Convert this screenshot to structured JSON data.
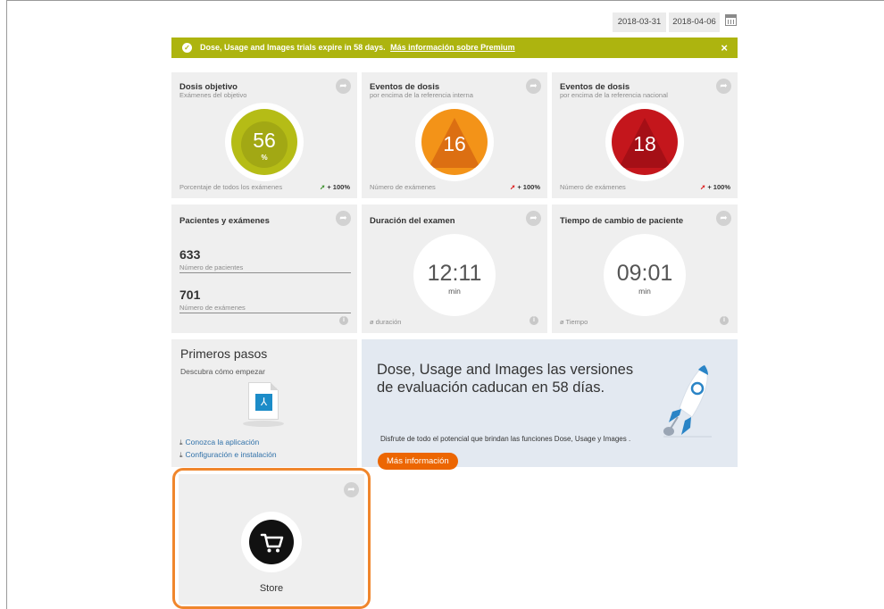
{
  "dates": {
    "from": "2018-03-31",
    "to": "2018-04-06"
  },
  "banner": {
    "message": "Dose, Usage and Images trials expire in 58 days.",
    "link": "Más información sobre Premium",
    "close": "×",
    "color": "#adb40f"
  },
  "tiles": {
    "target_dose": {
      "title": "Dosis objetivo",
      "subtitle": "Exámenes del objetivo",
      "value": "56",
      "unit": "%",
      "footer": "Porcentaje de todos los exámenes",
      "trend": "+ 100%",
      "color": "#b5bc16"
    },
    "dose_events_internal": {
      "title": "Eventos de dosis",
      "subtitle": "por encima de la referencia interna",
      "value": "16",
      "footer": "Número de exámenes",
      "trend": "+ 100%",
      "color": "#f39318"
    },
    "dose_events_national": {
      "title": "Eventos de dosis",
      "subtitle": "por encima de la referencia nacional",
      "value": "18",
      "footer": "Número de exámenes",
      "trend": "+ 100%",
      "color": "#c4161c"
    },
    "patients_exams": {
      "title": "Pacientes y exámenes",
      "patients_value": "633",
      "patients_label": "Número de pacientes",
      "exams_value": "701",
      "exams_label": "Número de exámenes"
    },
    "exam_duration": {
      "title": "Duración del examen",
      "time": "12:11",
      "unit": "min",
      "footer": "ø duración"
    },
    "patient_change": {
      "title": "Tiempo de cambio de paciente",
      "time": "09:01",
      "unit": "min",
      "footer": "ø Tiempo"
    },
    "getting_started": {
      "title": "Primeros pasos",
      "subtitle": "Descubra cómo empezar",
      "link1": "Conozca la aplicación",
      "link2": "Configuración e instalación"
    },
    "promo": {
      "heading": "Dose, Usage and Images las versiones de evaluación caducan en 58 días.",
      "text": "Disfrute de todo el potencial que brindan las funciones Dose, Usage y Images .",
      "button": "Más información",
      "button_color": "#ec6602"
    },
    "store": {
      "label": "Store",
      "highlight_color": "#f0862c"
    }
  },
  "icons": {
    "share": "share-arrow-icon",
    "info": "info-icon",
    "calendar": "calendar-icon",
    "check": "check-icon",
    "download": "download-icon",
    "pdf": "pdf-document-icon",
    "cart": "shopping-cart-icon",
    "rocket": "rocket-icon"
  }
}
